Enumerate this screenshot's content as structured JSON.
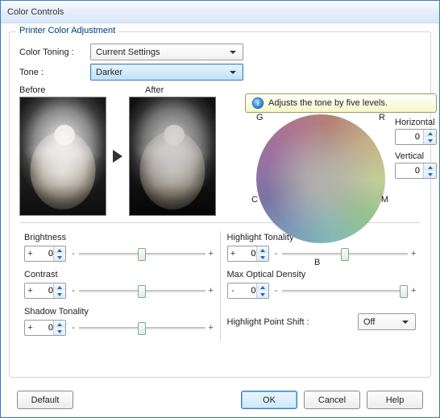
{
  "window": {
    "title": "Color Controls"
  },
  "group": {
    "title": "Printer Color Adjustment"
  },
  "fields": {
    "colorToning": {
      "label": "Color Toning :",
      "value": "Current Settings"
    },
    "tone": {
      "label": "Tone :",
      "value": "Darker"
    }
  },
  "preview": {
    "before": "Before",
    "after": "After"
  },
  "tooltip": {
    "text": "Adjusts the tone by five levels."
  },
  "wheel": {
    "labels": {
      "G": "G",
      "R": "R",
      "C": "C",
      "M": "M",
      "B": "B"
    },
    "horizontal": {
      "label": "Horizontal",
      "value": "0"
    },
    "vertical": {
      "label": "Vertical",
      "value": "0"
    }
  },
  "sliders": {
    "brightness": {
      "label": "Brightness",
      "sign": "+",
      "value": "0"
    },
    "contrast": {
      "label": "Contrast",
      "sign": "+",
      "value": "0"
    },
    "shadowTonality": {
      "label": "Shadow Tonality",
      "sign": "+",
      "value": "0"
    },
    "highlightTonality": {
      "label": "Highlight Tonality",
      "sign": "+",
      "value": "0"
    },
    "maxOpticalDensity": {
      "label": "Max Optical Density",
      "sign": "-",
      "value": "0"
    }
  },
  "highlightPointShift": {
    "label": "Highlight Point Shift :",
    "value": "Off"
  },
  "buttons": {
    "default": "Default",
    "ok": "OK",
    "cancel": "Cancel",
    "help": "Help"
  },
  "glyphs": {
    "minus": "-",
    "plus": "+"
  }
}
